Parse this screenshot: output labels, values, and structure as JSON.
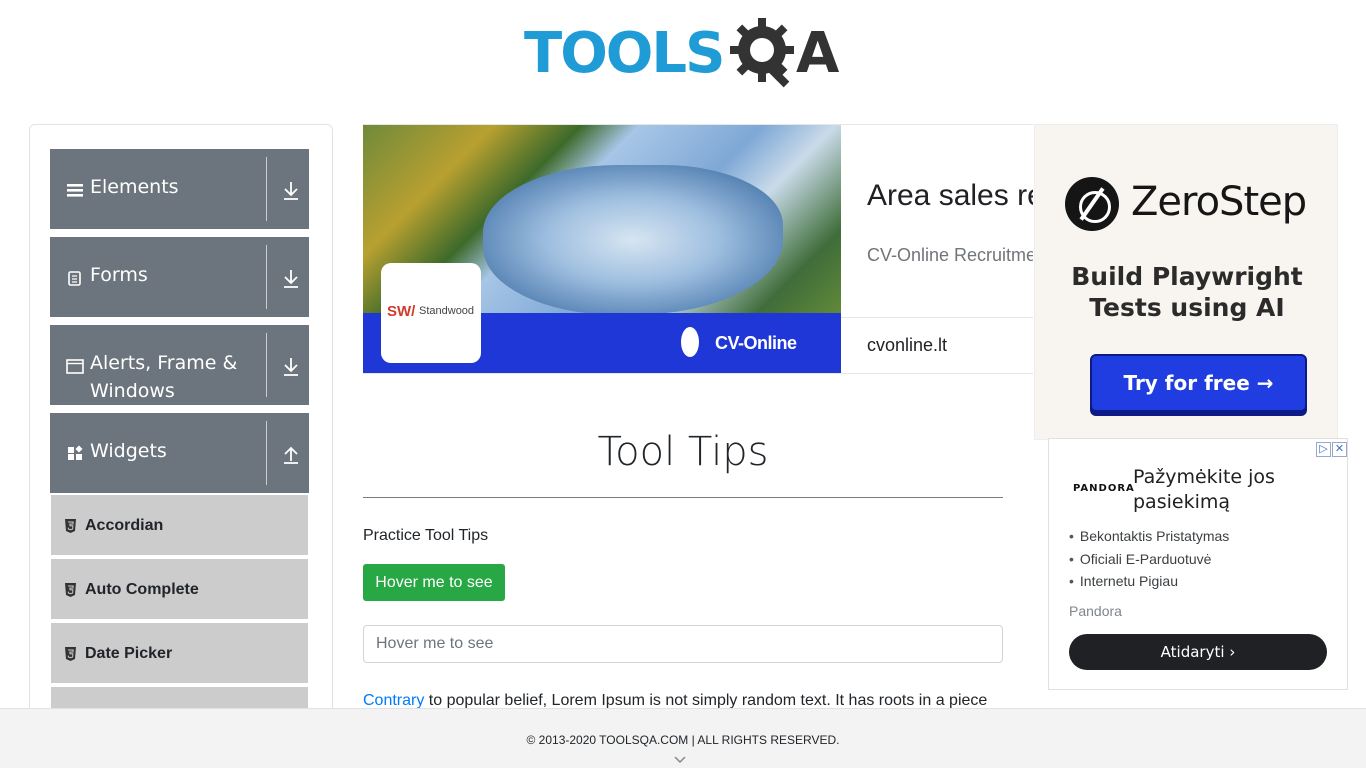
{
  "header": {
    "logo_text": "TOOLSQA"
  },
  "sidebar": {
    "groups": [
      {
        "label": "Elements",
        "icon": "hamburger-icon",
        "state": "collapsed"
      },
      {
        "label": "Forms",
        "icon": "document-icon",
        "state": "collapsed"
      },
      {
        "label": "Alerts, Frame & Windows",
        "icon": "window-icon",
        "state": "collapsed"
      },
      {
        "label": "Widgets",
        "icon": "widgets-icon",
        "state": "expanded"
      }
    ],
    "widget_items": [
      {
        "label": "Accordian",
        "icon": "html5-icon"
      },
      {
        "label": "Auto Complete",
        "icon": "html5-icon"
      },
      {
        "label": "Date Picker",
        "icon": "html5-icon"
      }
    ]
  },
  "banner_ad": {
    "title": "Area sales re",
    "subtitle": "CV-Online Recruitme",
    "domain": "cvonline.lt",
    "logo_text": "CV-Online",
    "sw_text": "SW/",
    "sw_brand": "Standwood"
  },
  "main": {
    "title": "Tool Tips",
    "practice_label": "Practice Tool Tips",
    "hover_button_label": "Hover me to see",
    "hover_input_placeholder": "Hover me to see",
    "paragraph_link": "Contrary",
    "paragraph_text": " to popular belief, Lorem Ipsum is not simply random text. It has roots in a piece"
  },
  "zerostep_ad": {
    "name": "ZeroStep",
    "tagline": "Build Playwright Tests using AI",
    "button_label": "Try for free →"
  },
  "pandora_ad": {
    "brand": "PANDORA",
    "headline": "Pažymėkite jos pasiekimą",
    "bullets": [
      "Bekontaktis Pristatymas",
      "Oficiali E-Parduotuvė",
      "Internetu Pigiau"
    ],
    "advertiser": "Pandora",
    "cta_label": "Atidaryti"
  },
  "footer": {
    "copyright": "© 2013-2020 TOOLSQA.COM | ALL RIGHTS RESERVED."
  },
  "colors": {
    "brand_blue": "#1f9bd5",
    "sidebar_group_bg": "#6c757d",
    "sidebar_item_bg": "#cccccc",
    "success_green": "#28a745",
    "link_blue": "#007bff"
  }
}
